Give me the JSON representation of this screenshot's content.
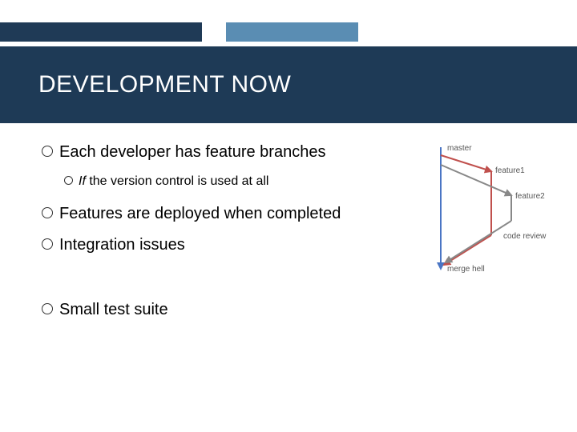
{
  "title": "DEVELOPMENT NOW",
  "bullets": {
    "b1": "Each developer has feature branches",
    "b1_sub_italic": "If",
    "b1_sub_rest": " the version control is used at all",
    "b2": "Features are deployed when completed",
    "b3": "Integration issues",
    "b4": "Small test suite"
  },
  "diagram": {
    "master": "master",
    "feature1": "feature1",
    "feature2": "feature2",
    "code_review": "code review",
    "merge_hell": "merge hell"
  },
  "colors": {
    "title_bg": "#1e3a56",
    "accent_blue": "#5a8db3"
  }
}
